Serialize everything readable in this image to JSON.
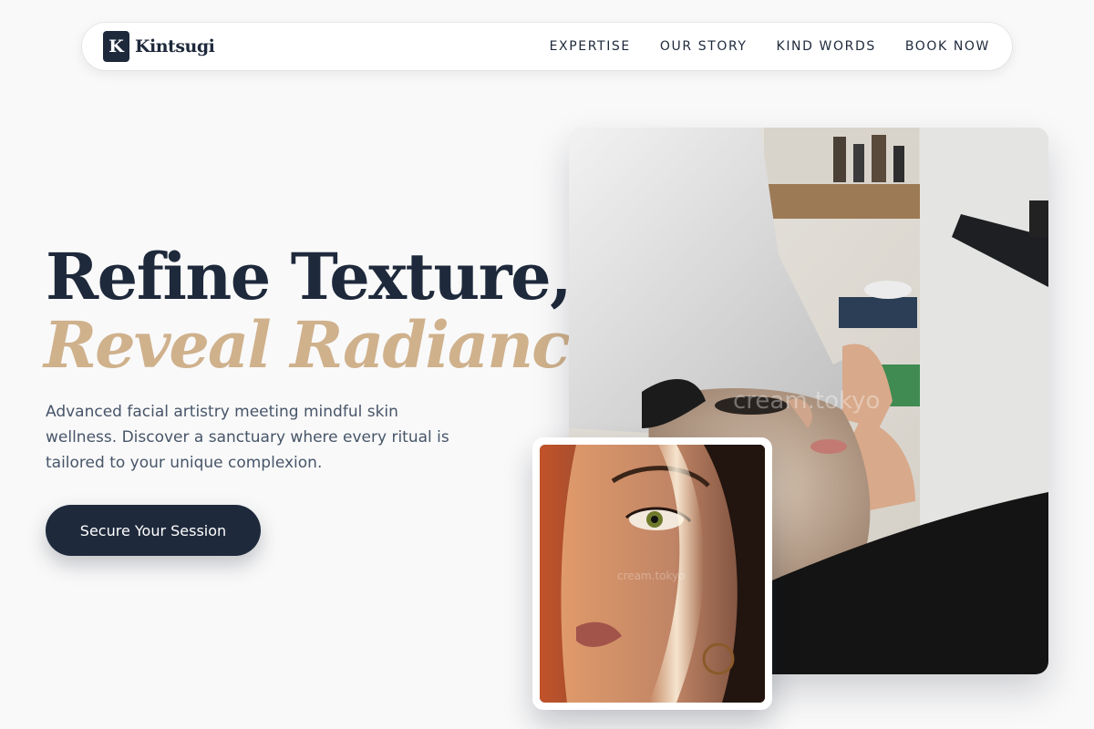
{
  "brand": {
    "mark": "K",
    "name": "Kintsugi"
  },
  "nav": {
    "links": [
      "EXPERTISE",
      "OUR STORY",
      "KIND WORDS",
      "BOOK NOW"
    ]
  },
  "hero": {
    "title": "Refine Texture,",
    "accent": "Reveal Radiance.",
    "description": "Advanced facial artistry meeting mindful skin wellness. Discover a sanctuary where every ritual is tailored to your unique complexion.",
    "cta_label": "Secure Your Session"
  },
  "images": {
    "main_watermark": "cream.tokyo",
    "inset_watermark": "cream.tokyo"
  },
  "colors": {
    "primary": "#1e293b",
    "accent": "#cfb18c",
    "background": "#f9f9f9",
    "muted_text": "#475569"
  }
}
